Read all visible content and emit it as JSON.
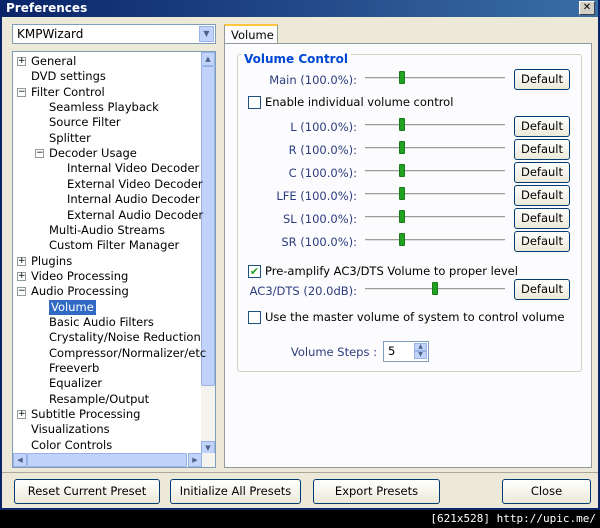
{
  "window": {
    "title": "Preferences"
  },
  "preset": {
    "value": "KMPWizard"
  },
  "tree": [
    {
      "label": "General",
      "level": 0,
      "expander": "+"
    },
    {
      "label": "DVD settings",
      "level": 0,
      "expander": ""
    },
    {
      "label": "Filter Control",
      "level": 0,
      "expander": "−"
    },
    {
      "label": "Seamless Playback",
      "level": 1,
      "expander": ""
    },
    {
      "label": "Source Filter",
      "level": 1,
      "expander": ""
    },
    {
      "label": "Splitter",
      "level": 1,
      "expander": ""
    },
    {
      "label": "Decoder Usage",
      "level": 1,
      "expander": "−"
    },
    {
      "label": "Internal Video Decoder",
      "level": 2,
      "expander": ""
    },
    {
      "label": "External Video Decoder",
      "level": 2,
      "expander": ""
    },
    {
      "label": "Internal Audio Decoder",
      "level": 2,
      "expander": ""
    },
    {
      "label": "External Audio Decoder",
      "level": 2,
      "expander": ""
    },
    {
      "label": "Multi-Audio Streams",
      "level": 1,
      "expander": ""
    },
    {
      "label": "Custom Filter Manager",
      "level": 1,
      "expander": ""
    },
    {
      "label": "Plugins",
      "level": 0,
      "expander": "+"
    },
    {
      "label": "Video Processing",
      "level": 0,
      "expander": "+"
    },
    {
      "label": "Audio Processing",
      "level": 0,
      "expander": "−"
    },
    {
      "label": "Volume",
      "level": 1,
      "expander": "",
      "selected": true
    },
    {
      "label": "Basic Audio Filters",
      "level": 1,
      "expander": ""
    },
    {
      "label": "Crystality/Noise Reduction",
      "level": 1,
      "expander": ""
    },
    {
      "label": "Compressor/Normalizer/etc",
      "level": 1,
      "expander": ""
    },
    {
      "label": "Freeverb",
      "level": 1,
      "expander": ""
    },
    {
      "label": "Equalizer",
      "level": 1,
      "expander": ""
    },
    {
      "label": "Resample/Output",
      "level": 1,
      "expander": ""
    },
    {
      "label": "Subtitle Processing",
      "level": 0,
      "expander": "+"
    },
    {
      "label": "Visualizations",
      "level": 0,
      "expander": ""
    },
    {
      "label": "Color Controls",
      "level": 0,
      "expander": ""
    }
  ],
  "tab": {
    "label": "Volume"
  },
  "volume": {
    "group_title": "Volume Control",
    "main_label": "Main (100.0%):",
    "default_label": "Default",
    "enable_individual": "Enable individual volume control",
    "channels": [
      {
        "label": "L (100.0%):",
        "level": 0.25
      },
      {
        "label": "R (100.0%):",
        "level": 0.25
      },
      {
        "label": "C (100.0%):",
        "level": 0.25
      },
      {
        "label": "LFE (100.0%):",
        "level": 0.25
      },
      {
        "label": "SL (100.0%):",
        "level": 0.25
      },
      {
        "label": "SR (100.0%):",
        "level": 0.25
      }
    ],
    "main_level": 0.25,
    "preamp_label": "Pre-amplify AC3/DTS Volume to proper level",
    "preamp_checked": true,
    "ac3_label": "AC3/DTS (20.0dB):",
    "ac3_level": 0.5,
    "master_label": "Use the master volume of system to control volume",
    "master_checked": false,
    "steps_label": "Volume Steps :",
    "steps_value": "5"
  },
  "footer": {
    "reset": "Reset Current Preset",
    "init": "Initialize All Presets",
    "export": "Export Presets",
    "close": "Close"
  },
  "statusbar": {
    "text": "[621x528] http://upic.me/"
  }
}
